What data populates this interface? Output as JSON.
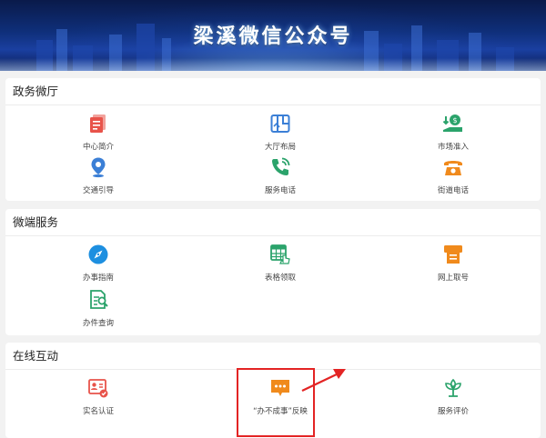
{
  "header": {
    "title": "梁溪微信公众号"
  },
  "sections": [
    {
      "title": "政务微厅",
      "items": [
        {
          "label": "中心简介",
          "icon": "document-stack-icon",
          "color": "#e8534a"
        },
        {
          "label": "大厅布局",
          "icon": "map-layout-icon",
          "color": "#3b7fd6"
        },
        {
          "label": "市场准入",
          "icon": "market-access-icon",
          "color": "#2ba36b"
        },
        {
          "label": "交通引导",
          "icon": "location-pin-icon",
          "color": "#3b7fd6"
        },
        {
          "label": "服务电话",
          "icon": "phone-call-icon",
          "color": "#2ba36b"
        },
        {
          "label": "街道电话",
          "icon": "telephone-icon",
          "color": "#f08a1c"
        }
      ]
    },
    {
      "title": "微端服务",
      "items": [
        {
          "label": "办事指南",
          "icon": "compass-icon",
          "color": "#1d8fe0"
        },
        {
          "label": "表格领取",
          "icon": "table-form-icon",
          "color": "#2ba36b"
        },
        {
          "label": "网上取号",
          "icon": "ticket-machine-icon",
          "color": "#f08a1c"
        },
        {
          "label": "办件查询",
          "icon": "document-search-icon",
          "color": "#2ba36b"
        }
      ]
    },
    {
      "title": "在线互动",
      "items": [
        {
          "label": "实名认证",
          "icon": "id-card-icon",
          "color": "#e8534a"
        },
        {
          "label": "“办不成事”反映",
          "icon": "chat-bubble-icon",
          "color": "#f08a1c"
        },
        {
          "label": "服务评价",
          "icon": "flower-rating-icon",
          "color": "#2ba36b"
        }
      ]
    }
  ],
  "annotation": {
    "color": "#e32424"
  }
}
